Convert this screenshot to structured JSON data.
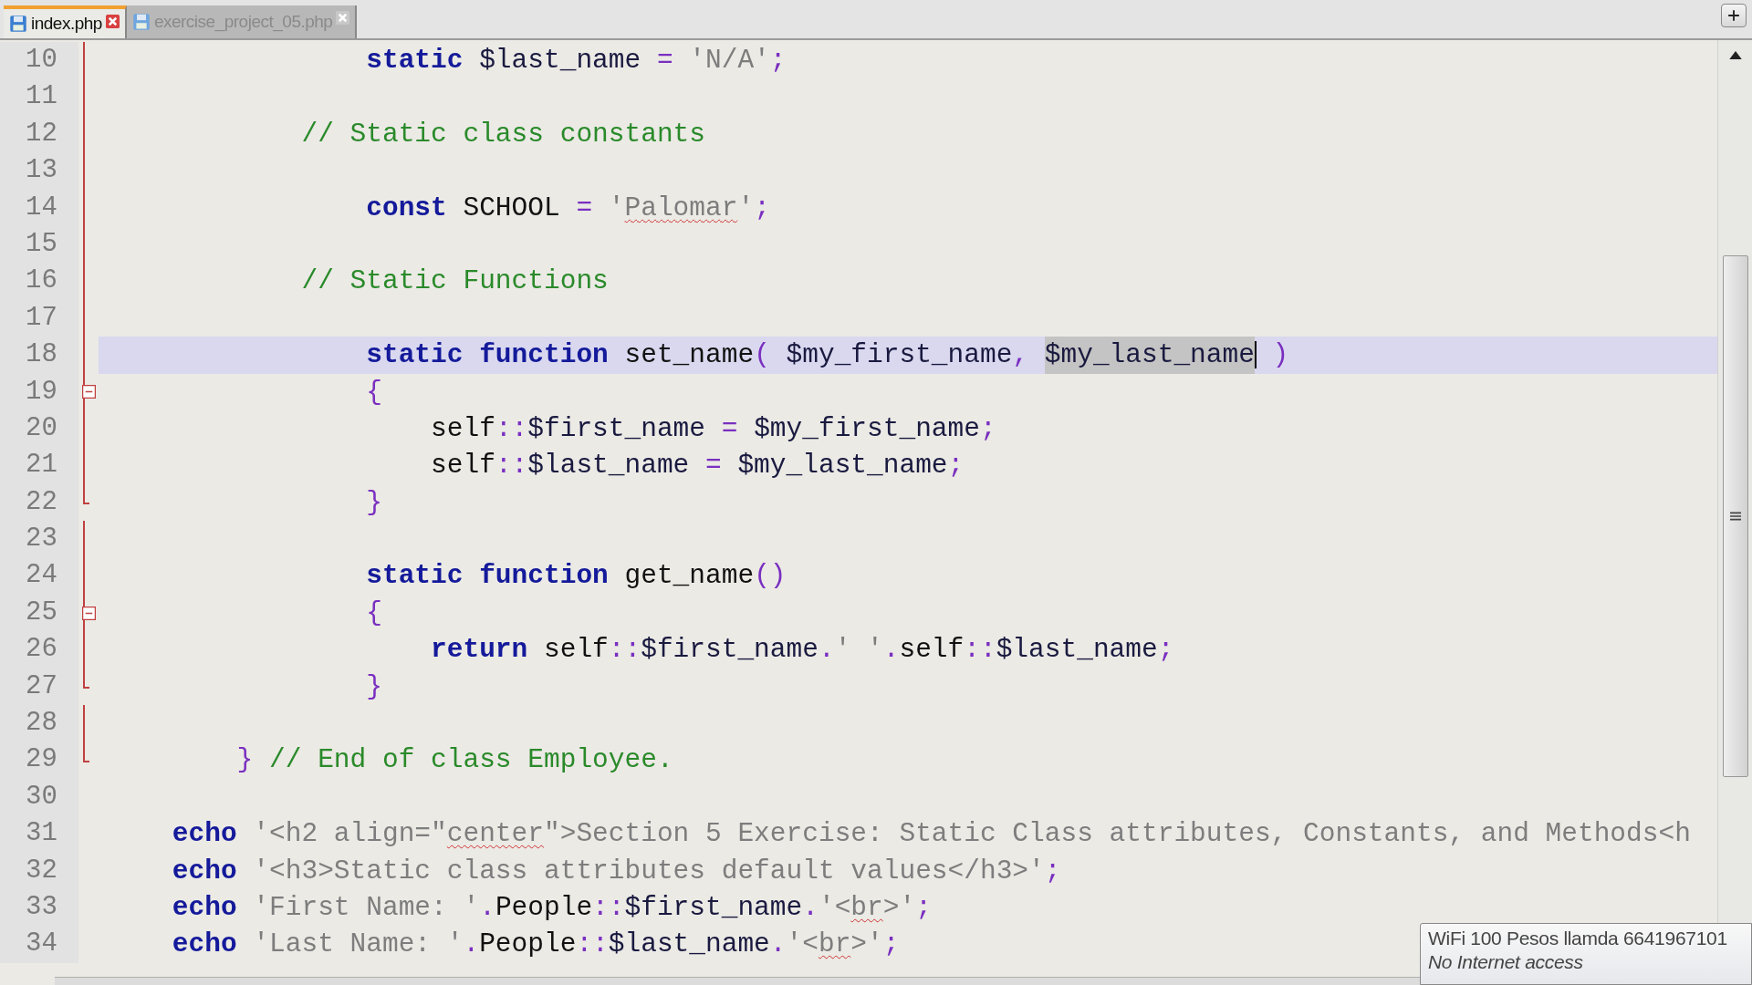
{
  "tabs": [
    {
      "label": "index.php",
      "selected": true
    },
    {
      "label": "exercise_project_05.php",
      "selected": false
    }
  ],
  "editor": {
    "lines": [
      {
        "number": "10",
        "in_fold": true,
        "fold_start": false,
        "fold_end": false,
        "current": false,
        "tokens": [
          {
            "kind": "keyword",
            "text": "                static"
          },
          {
            "kind": "variable",
            "text": " $last_name"
          },
          {
            "kind": "operator",
            "text": " = "
          },
          {
            "kind": "string",
            "text": "'N/A'"
          },
          {
            "kind": "operator",
            "text": ";"
          }
        ]
      },
      {
        "number": "11",
        "in_fold": true,
        "fold_start": false,
        "fold_end": false,
        "current": false
      },
      {
        "number": "12",
        "in_fold": true,
        "fold_start": false,
        "fold_end": false,
        "current": false,
        "tokens": [
          {
            "kind": "comment",
            "text": "            // Static class constants"
          }
        ]
      },
      {
        "number": "13",
        "in_fold": true,
        "fold_start": false,
        "fold_end": false,
        "current": false
      },
      {
        "number": "14",
        "in_fold": true,
        "fold_start": false,
        "fold_end": false,
        "current": false,
        "tokens": [
          {
            "kind": "keyword",
            "text": "                const"
          },
          {
            "kind": "plain",
            "text": " SCHOOL"
          },
          {
            "kind": "operator",
            "text": " = "
          },
          {
            "kind": "string",
            "text": "'"
          },
          {
            "kind": "string",
            "text": "Palomar",
            "misspelled": true
          },
          {
            "kind": "string",
            "text": "'"
          },
          {
            "kind": "operator",
            "text": ";"
          }
        ]
      },
      {
        "number": "15",
        "in_fold": true,
        "fold_start": false,
        "fold_end": false,
        "current": false
      },
      {
        "number": "16",
        "in_fold": true,
        "fold_start": false,
        "fold_end": false,
        "current": false,
        "tokens": [
          {
            "kind": "comment",
            "text": "            // Static Functions"
          }
        ]
      },
      {
        "number": "17",
        "in_fold": true,
        "fold_start": false,
        "fold_end": false,
        "current": false
      },
      {
        "number": "18",
        "in_fold": true,
        "fold_start": false,
        "fold_end": false,
        "current": true,
        "tokens": [
          {
            "kind": "keyword",
            "text": "                static"
          },
          {
            "kind": "keyword",
            "text": " function"
          },
          {
            "kind": "plain",
            "text": " set_name"
          },
          {
            "kind": "operator",
            "text": "("
          },
          {
            "kind": "variable",
            "text": " $my_first_name"
          },
          {
            "kind": "operator",
            "text": ", "
          },
          {
            "kind": "variable",
            "text": "$my_last_name",
            "selected": true
          },
          {
            "kind": "operator",
            "text": " )"
          }
        ]
      },
      {
        "number": "19",
        "in_fold": true,
        "fold_start": true,
        "fold_end": false,
        "current": false,
        "tokens": [
          {
            "kind": "operator",
            "text": "                {"
          }
        ]
      },
      {
        "number": "20",
        "in_fold": true,
        "fold_start": false,
        "fold_end": false,
        "current": false,
        "tokens": [
          {
            "kind": "plain",
            "text": "                    self"
          },
          {
            "kind": "operator",
            "text": "::"
          },
          {
            "kind": "variable",
            "text": "$first_name"
          },
          {
            "kind": "operator",
            "text": " = "
          },
          {
            "kind": "variable",
            "text": "$my_first_name"
          },
          {
            "kind": "operator",
            "text": ";"
          }
        ]
      },
      {
        "number": "21",
        "in_fold": true,
        "fold_start": false,
        "fold_end": false,
        "current": false,
        "tokens": [
          {
            "kind": "plain",
            "text": "                    self"
          },
          {
            "kind": "operator",
            "text": "::"
          },
          {
            "kind": "variable",
            "text": "$last_name"
          },
          {
            "kind": "operator",
            "text": " = "
          },
          {
            "kind": "variable",
            "text": "$my_last_name"
          },
          {
            "kind": "operator",
            "text": ";"
          }
        ]
      },
      {
        "number": "22",
        "in_fold": true,
        "fold_start": false,
        "fold_end": true,
        "current": false,
        "tokens": [
          {
            "kind": "operator",
            "text": "                }"
          }
        ]
      },
      {
        "number": "23",
        "in_fold": true,
        "fold_start": false,
        "fold_end": false,
        "current": false
      },
      {
        "number": "24",
        "in_fold": true,
        "fold_start": false,
        "fold_end": false,
        "current": false,
        "tokens": [
          {
            "kind": "keyword",
            "text": "                static"
          },
          {
            "kind": "keyword",
            "text": " function"
          },
          {
            "kind": "plain",
            "text": " get_name"
          },
          {
            "kind": "operator",
            "text": "()"
          }
        ]
      },
      {
        "number": "25",
        "in_fold": true,
        "fold_start": true,
        "fold_end": false,
        "current": false,
        "tokens": [
          {
            "kind": "operator",
            "text": "                {"
          }
        ]
      },
      {
        "number": "26",
        "in_fold": true,
        "fold_start": false,
        "fold_end": false,
        "current": false,
        "tokens": [
          {
            "kind": "keyword",
            "text": "                    return"
          },
          {
            "kind": "plain",
            "text": " self"
          },
          {
            "kind": "operator",
            "text": "::"
          },
          {
            "kind": "variable",
            "text": "$first_name"
          },
          {
            "kind": "operator",
            "text": "."
          },
          {
            "kind": "string",
            "text": "' '"
          },
          {
            "kind": "operator",
            "text": "."
          },
          {
            "kind": "plain",
            "text": "self"
          },
          {
            "kind": "operator",
            "text": "::"
          },
          {
            "kind": "variable",
            "text": "$last_name"
          },
          {
            "kind": "operator",
            "text": ";"
          }
        ]
      },
      {
        "number": "27",
        "in_fold": true,
        "fold_start": false,
        "fold_end": true,
        "current": false,
        "tokens": [
          {
            "kind": "operator",
            "text": "                }"
          }
        ]
      },
      {
        "number": "28",
        "in_fold": true,
        "fold_start": false,
        "fold_end": false,
        "current": false
      },
      {
        "number": "29",
        "in_fold": true,
        "fold_start": false,
        "fold_end": true,
        "current": false,
        "tokens": [
          {
            "kind": "operator",
            "text": "        }"
          },
          {
            "kind": "comment",
            "text": " // End of class Employee."
          }
        ]
      },
      {
        "number": "30",
        "in_fold": false,
        "fold_start": false,
        "fold_end": false,
        "current": false
      },
      {
        "number": "31",
        "in_fold": false,
        "fold_start": false,
        "fold_end": false,
        "current": false,
        "tokens": [
          {
            "kind": "keyword",
            "text": "    echo"
          },
          {
            "kind": "string",
            "text": " '<h2 align=\""
          },
          {
            "kind": "string",
            "text": "center",
            "misspelled": true
          },
          {
            "kind": "string",
            "text": "\">Section 5 Exercise: Static Class attributes, Constants, and Methods<h"
          }
        ]
      },
      {
        "number": "32",
        "in_fold": false,
        "fold_start": false,
        "fold_end": false,
        "current": false,
        "tokens": [
          {
            "kind": "keyword",
            "text": "    echo"
          },
          {
            "kind": "string",
            "text": " '<h3>Static class attributes default values</h3>'"
          },
          {
            "kind": "operator",
            "text": ";"
          }
        ]
      },
      {
        "number": "33",
        "in_fold": false,
        "fold_start": false,
        "fold_end": false,
        "current": false,
        "tokens": [
          {
            "kind": "keyword",
            "text": "    echo"
          },
          {
            "kind": "string",
            "text": " 'First Name: '"
          },
          {
            "kind": "operator",
            "text": "."
          },
          {
            "kind": "plain",
            "text": "People"
          },
          {
            "kind": "operator",
            "text": "::"
          },
          {
            "kind": "variable",
            "text": "$first_name"
          },
          {
            "kind": "operator",
            "text": "."
          },
          {
            "kind": "string",
            "text": "'<"
          },
          {
            "kind": "string",
            "text": "br",
            "misspelled": true
          },
          {
            "kind": "string",
            "text": ">'"
          },
          {
            "kind": "operator",
            "text": ";"
          }
        ]
      },
      {
        "number": "34",
        "in_fold": false,
        "fold_start": false,
        "fold_end": false,
        "current": false,
        "tokens": [
          {
            "kind": "keyword",
            "text": "    echo"
          },
          {
            "kind": "string",
            "text": " 'Last Name: '"
          },
          {
            "kind": "operator",
            "text": "."
          },
          {
            "kind": "plain",
            "text": "People"
          },
          {
            "kind": "operator",
            "text": "::"
          },
          {
            "kind": "variable",
            "text": "$last_name"
          },
          {
            "kind": "operator",
            "text": "."
          },
          {
            "kind": "string",
            "text": "'<"
          },
          {
            "kind": "string",
            "text": "br",
            "misspelled": true
          },
          {
            "kind": "string",
            "text": ">'"
          },
          {
            "kind": "operator",
            "text": ";"
          }
        ]
      }
    ]
  },
  "network_tooltip": {
    "title": "WiFi 100 Pesos llamda 6641967101",
    "status": "No Internet access"
  }
}
